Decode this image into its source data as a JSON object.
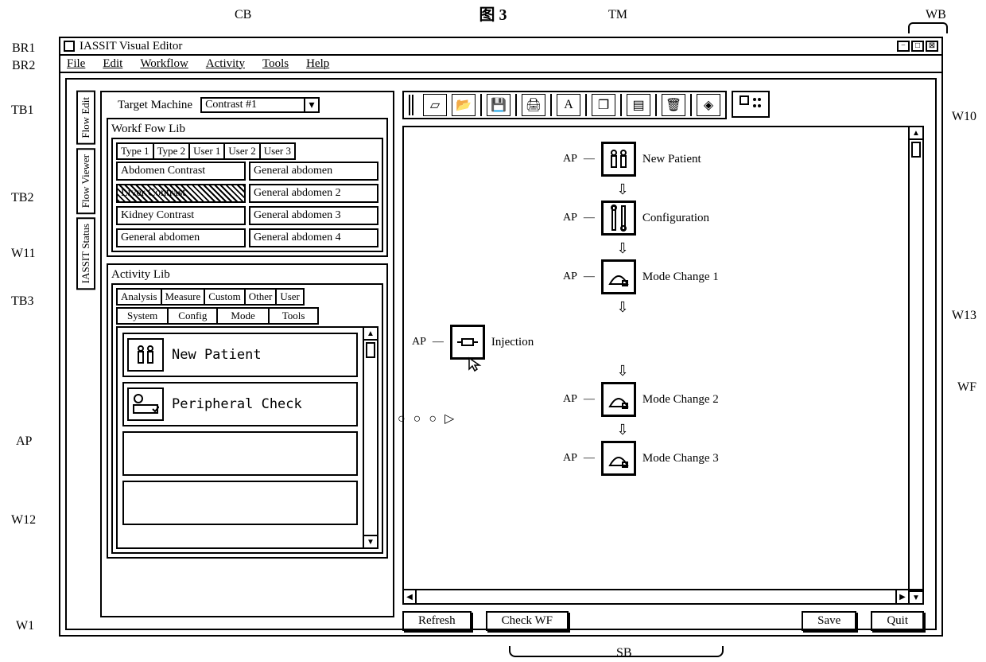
{
  "figure_title": "图 3",
  "annotations": {
    "CB": "CB",
    "TM": "TM",
    "WB": "WB",
    "BR1": "BR1",
    "BR2": "BR2",
    "TB1": "TB1",
    "TB2": "TB2",
    "TB3": "TB3",
    "W11": "W11",
    "W12": "W12",
    "W1": "W1",
    "W10": "W10",
    "W13": "W13",
    "WF": "WF",
    "SB": "SB",
    "AP": "AP"
  },
  "window": {
    "title": "IASSIT Visual Editor"
  },
  "menubar": [
    "File",
    "Edit",
    "Workflow",
    "Activity",
    "Tools",
    "Help"
  ],
  "side_tabs": [
    "Flow Edit",
    "Flow Viewer",
    "IASSIT Status"
  ],
  "target_machine": {
    "label": "Target Machine",
    "value": "Contrast #1"
  },
  "workflow_lib": {
    "title": "Workf Fow Lib",
    "tabs": [
      "Type 1",
      "Type 2",
      "User 1",
      "User 2",
      "User 3"
    ],
    "items_left": [
      "Abdomen Contrast",
      "Liver Contrast",
      "Kidney Contrast",
      "General abdomen"
    ],
    "items_right": [
      "General abdomen",
      "General abdomen 2",
      "General abdomen 3",
      "General abdomen 4"
    ],
    "selected": "Liver Contrast"
  },
  "activity_lib": {
    "title": "Activity Lib",
    "tabs_row1": [
      "Analysis",
      "Measure",
      "Custom",
      "Other",
      "User"
    ],
    "tabs_row2": [
      "System",
      "Config",
      "Mode",
      "Tools"
    ],
    "items": [
      {
        "label": "New Patient",
        "icon": "people"
      },
      {
        "label": "Peripheral Check",
        "icon": "periph"
      }
    ]
  },
  "toolbar_icons": [
    "new",
    "open",
    "save",
    "print",
    "text",
    "copy",
    "list",
    "trash",
    "help"
  ],
  "flow_nodes": [
    {
      "id": "n1",
      "label": "New Patient",
      "icon": "people",
      "ap": "AP"
    },
    {
      "id": "n2",
      "label": "Configuration",
      "icon": "tools",
      "ap": "AP"
    },
    {
      "id": "n3",
      "label": "Mode Change 1",
      "icon": "probe",
      "ap": "AP"
    },
    {
      "id": "n5",
      "label": "Mode Change 2",
      "icon": "probe",
      "ap": "AP"
    },
    {
      "id": "n6",
      "label": "Mode Change 3",
      "icon": "probe",
      "ap": "AP"
    }
  ],
  "floating_node": {
    "label": "Injection",
    "icon": "syringe",
    "ap": "AP"
  },
  "bottom_buttons": [
    "Refresh",
    "Check WF",
    "Save",
    "Quit"
  ]
}
